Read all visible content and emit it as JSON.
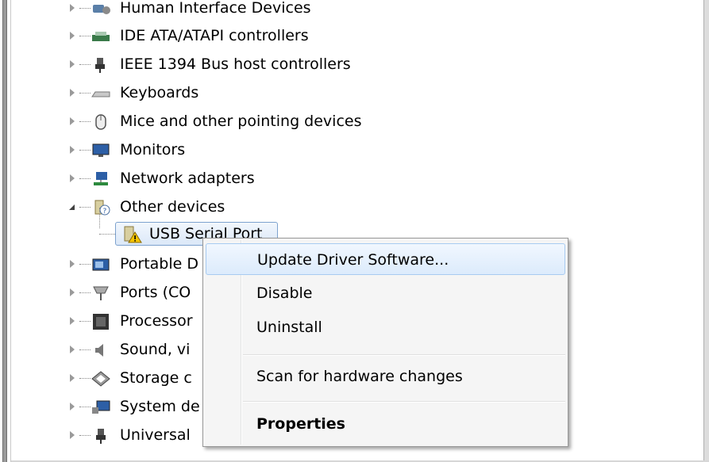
{
  "tree": {
    "items": [
      {
        "label": "Human Interface Devices",
        "icon": "hid-icon",
        "color": "#5a7fa8",
        "expanded": false
      },
      {
        "label": "IDE ATA/ATAPI controllers",
        "icon": "ide-controller-icon",
        "color": "#3a7a4a",
        "expanded": false
      },
      {
        "label": "IEEE 1394 Bus host controllers",
        "icon": "firewire-plug-icon",
        "color": "#555555",
        "expanded": false
      },
      {
        "label": "Keyboards",
        "icon": "keyboard-icon",
        "color": "#8a8a8a",
        "expanded": false
      },
      {
        "label": "Mice and other pointing devices",
        "icon": "mouse-icon",
        "color": "#6a6a6a",
        "expanded": false
      },
      {
        "label": "Monitors",
        "icon": "monitor-icon",
        "color": "#2d5fa6",
        "expanded": false
      },
      {
        "label": "Network adapters",
        "icon": "network-adapter-icon",
        "color": "#2d8a3e",
        "expanded": false
      },
      {
        "label": "Other devices",
        "icon": "unknown-device-icon",
        "color": "#b8a25c",
        "expanded": true
      },
      {
        "label": "Portable D",
        "icon": "portable-device-icon",
        "color": "#2d5fa6",
        "expanded": false
      },
      {
        "label": "Ports (CO",
        "icon": "port-icon",
        "color": "#7a7a7a",
        "expanded": false
      },
      {
        "label": "Processor",
        "icon": "processor-icon",
        "color": "#333333",
        "expanded": false
      },
      {
        "label": "Sound, vi",
        "icon": "speaker-icon",
        "color": "#777777",
        "expanded": false
      },
      {
        "label": "Storage c",
        "icon": "storage-icon",
        "color": "#666666",
        "expanded": false
      },
      {
        "label": "System de",
        "icon": "system-device-icon",
        "color": "#2d5fa6",
        "expanded": false
      },
      {
        "label": "Universal",
        "icon": "usb-plug-icon",
        "color": "#555555",
        "expanded": false
      }
    ],
    "selected_child": {
      "label": "USB Serial Port",
      "icon": "warning-device-icon"
    }
  },
  "context_menu": {
    "items": [
      {
        "label": "Update Driver Software...",
        "hover": true,
        "bold": false
      },
      {
        "label": "Disable",
        "hover": false,
        "bold": false
      },
      {
        "label": "Uninstall",
        "hover": false,
        "bold": false
      },
      {
        "label": "Scan for hardware changes",
        "hover": false,
        "bold": false
      },
      {
        "label": "Properties",
        "hover": false,
        "bold": true
      }
    ]
  },
  "colors": {
    "selection_border": "#7da2ce",
    "menu_hover_border": "#a8cbf1",
    "warning": "#f5c400"
  }
}
